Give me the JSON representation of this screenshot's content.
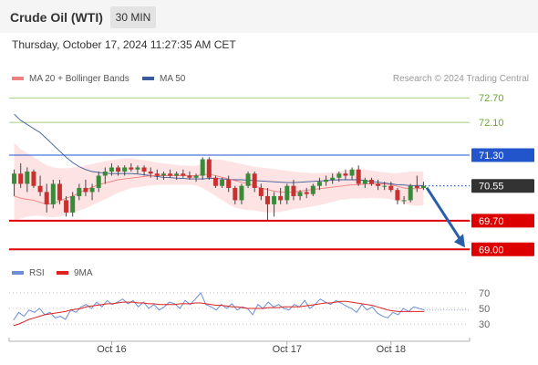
{
  "header": {
    "instrument": "Crude Oil (WTI)",
    "timeframe": "30 MIN"
  },
  "timestamp": "Thursday, October 17, 2024 11:27:35 AM CET",
  "legend": {
    "ma20": {
      "label": "MA 20 + Bollinger Bands",
      "color": "#f08080"
    },
    "ma50": {
      "label": "MA 50",
      "color": "#3a5a9a"
    }
  },
  "source": "Research © 2024 Trading Central",
  "rsi_legend": {
    "rsi": {
      "label": "RSI",
      "color": "#6b8ed6"
    },
    "ma9": {
      "label": "9MA",
      "color": "#dd2222"
    }
  },
  "chart_data": {
    "type": "candlestick",
    "price_levels": [
      {
        "value": 72.7,
        "label": "72.70",
        "color": "#8bbf57",
        "style": "thin"
      },
      {
        "value": 72.1,
        "label": "72.10",
        "color": "#8bbf57",
        "style": "thin"
      },
      {
        "value": 71.3,
        "label": "71.30",
        "color": "#2255cc",
        "badge": "#2255cc",
        "badge_text": "#ffffff"
      },
      {
        "value": 70.55,
        "label": "70.55",
        "color": "#555555",
        "badge": "#333333",
        "badge_text": "#ffffff",
        "current": true
      },
      {
        "value": 69.7,
        "label": "69.70",
        "color": "#dd0000",
        "badge": "#dd0000",
        "badge_text": "#ffffff"
      },
      {
        "value": 69.0,
        "label": "69.00",
        "color": "#dd0000",
        "badge": "#dd0000",
        "badge_text": "#ffffff"
      }
    ],
    "price_range": [
      68.85,
      72.95
    ],
    "projection": {
      "from": 70.55,
      "to": 69.0
    },
    "candles": [
      [
        70.6,
        70.95,
        70.3,
        70.85
      ],
      [
        70.85,
        71.1,
        70.5,
        70.6
      ],
      [
        70.6,
        71.0,
        70.4,
        70.9
      ],
      [
        70.9,
        70.95,
        70.5,
        70.55
      ],
      [
        70.55,
        70.8,
        70.3,
        70.4
      ],
      [
        70.4,
        70.6,
        69.9,
        70.1
      ],
      [
        70.1,
        70.7,
        70.0,
        70.6
      ],
      [
        70.6,
        70.7,
        70.1,
        70.2
      ],
      [
        70.2,
        70.3,
        69.8,
        69.9
      ],
      [
        69.9,
        70.4,
        69.8,
        70.3
      ],
      [
        70.3,
        70.6,
        70.2,
        70.5
      ],
      [
        70.5,
        70.7,
        70.3,
        70.4
      ],
      [
        70.4,
        70.6,
        70.2,
        70.5
      ],
      [
        70.5,
        70.9,
        70.4,
        70.8
      ],
      [
        70.8,
        71.0,
        70.6,
        70.9
      ],
      [
        70.9,
        71.1,
        70.8,
        71.0
      ],
      [
        71.0,
        71.05,
        70.8,
        70.9
      ],
      [
        70.9,
        71.05,
        70.8,
        71.0
      ],
      [
        71.0,
        71.1,
        70.9,
        70.95
      ],
      [
        70.95,
        71.05,
        70.85,
        71.0
      ],
      [
        71.0,
        71.05,
        70.8,
        70.9
      ],
      [
        70.9,
        71.0,
        70.75,
        70.85
      ],
      [
        70.85,
        70.95,
        70.7,
        70.8
      ],
      [
        70.8,
        70.9,
        70.7,
        70.85
      ],
      [
        70.85,
        70.95,
        70.75,
        70.8
      ],
      [
        70.8,
        70.9,
        70.7,
        70.85
      ],
      [
        70.85,
        70.95,
        70.75,
        70.8
      ],
      [
        70.8,
        70.9,
        70.7,
        70.75
      ],
      [
        70.75,
        70.85,
        70.65,
        70.8
      ],
      [
        70.8,
        71.25,
        70.7,
        71.2
      ],
      [
        71.2,
        71.25,
        70.7,
        70.75
      ],
      [
        70.75,
        70.8,
        70.5,
        70.55
      ],
      [
        70.55,
        70.75,
        70.5,
        70.7
      ],
      [
        70.7,
        70.8,
        70.4,
        70.5
      ],
      [
        70.5,
        70.55,
        70.1,
        70.2
      ],
      [
        70.2,
        70.6,
        70.1,
        70.55
      ],
      [
        70.55,
        70.9,
        70.5,
        70.85
      ],
      [
        70.85,
        70.9,
        70.4,
        70.5
      ],
      [
        70.5,
        70.6,
        70.2,
        70.3
      ],
      [
        70.3,
        70.5,
        69.7,
        70.1
      ],
      [
        70.1,
        70.4,
        69.8,
        70.3
      ],
      [
        70.3,
        70.5,
        70.1,
        70.2
      ],
      [
        70.2,
        70.6,
        70.1,
        70.55
      ],
      [
        70.55,
        70.7,
        70.2,
        70.3
      ],
      [
        70.3,
        70.45,
        70.2,
        70.4
      ],
      [
        70.4,
        70.5,
        70.25,
        70.35
      ],
      [
        70.35,
        70.6,
        70.3,
        70.55
      ],
      [
        70.55,
        70.75,
        70.45,
        70.65
      ],
      [
        70.65,
        70.8,
        70.55,
        70.7
      ],
      [
        70.7,
        70.85,
        70.6,
        70.75
      ],
      [
        70.75,
        70.9,
        70.65,
        70.85
      ],
      [
        70.85,
        70.95,
        70.7,
        70.8
      ],
      [
        70.8,
        71.0,
        70.7,
        70.95
      ],
      [
        70.95,
        71.05,
        70.55,
        70.6
      ],
      [
        70.6,
        70.75,
        70.5,
        70.7
      ],
      [
        70.7,
        70.75,
        70.55,
        70.6
      ],
      [
        70.6,
        70.7,
        70.45,
        70.55
      ],
      [
        70.55,
        70.65,
        70.45,
        70.55
      ],
      [
        70.55,
        70.65,
        70.4,
        70.45
      ],
      [
        70.45,
        70.5,
        70.1,
        70.2
      ],
      [
        70.2,
        70.3,
        70.1,
        70.2
      ],
      [
        70.2,
        70.6,
        70.15,
        70.55
      ],
      [
        70.55,
        70.8,
        70.4,
        70.5
      ],
      [
        70.5,
        70.65,
        70.45,
        70.55
      ]
    ],
    "ma20": [
      70.3,
      70.25,
      70.22,
      70.2,
      70.15,
      70.1,
      70.12,
      70.18,
      70.25,
      70.3,
      70.38,
      70.45,
      70.52,
      70.58,
      70.62,
      70.66,
      70.7,
      70.72,
      70.74,
      70.76,
      70.78,
      70.8,
      70.8,
      70.8,
      70.8,
      70.8,
      70.8,
      70.8,
      70.8,
      70.82,
      70.84,
      70.8,
      70.76,
      70.72,
      70.68,
      70.64,
      70.6,
      70.55,
      70.5,
      70.46,
      70.42,
      70.4,
      70.4,
      70.4,
      70.42,
      70.44,
      70.46,
      70.48,
      70.5,
      70.52,
      70.54,
      70.56,
      70.58,
      70.58,
      70.6,
      70.6,
      70.6,
      70.6,
      70.58,
      70.54,
      70.5,
      70.48,
      70.48,
      70.5
    ],
    "bb_upper": [
      71.6,
      71.45,
      71.35,
      71.25,
      71.15,
      71.05,
      71.0,
      70.98,
      70.98,
      71.0,
      71.02,
      71.05,
      71.08,
      71.12,
      71.15,
      71.18,
      71.2,
      71.22,
      71.22,
      71.2,
      71.18,
      71.15,
      71.12,
      71.1,
      71.08,
      71.06,
      71.05,
      71.04,
      71.04,
      71.1,
      71.18,
      71.2,
      71.18,
      71.15,
      71.12,
      71.08,
      71.05,
      71.02,
      71.0,
      70.98,
      70.96,
      70.94,
      70.92,
      70.9,
      70.88,
      70.87,
      70.86,
      70.86,
      70.87,
      70.88,
      70.9,
      70.92,
      70.95,
      70.96,
      70.95,
      70.92,
      70.9,
      70.88,
      70.86,
      70.86,
      70.88,
      70.9,
      70.9,
      70.9
    ],
    "bb_lower": [
      69.7,
      69.75,
      69.8,
      69.82,
      69.82,
      69.8,
      69.78,
      69.8,
      69.85,
      69.9,
      69.95,
      70.0,
      70.08,
      70.15,
      70.22,
      70.3,
      70.38,
      70.44,
      70.5,
      70.52,
      70.54,
      70.56,
      70.57,
      70.58,
      70.58,
      70.58,
      70.58,
      70.58,
      70.56,
      70.5,
      70.4,
      70.3,
      70.2,
      70.1,
      70.02,
      69.98,
      69.96,
      69.95,
      69.92,
      69.9,
      69.9,
      69.92,
      69.95,
      69.98,
      70.0,
      70.02,
      70.05,
      70.08,
      70.12,
      70.16,
      70.2,
      70.22,
      70.24,
      70.24,
      70.25,
      70.26,
      70.25,
      70.24,
      70.22,
      70.18,
      70.12,
      70.08,
      70.06,
      70.08
    ],
    "ma50": [
      72.3,
      72.15,
      72.05,
      71.95,
      71.85,
      71.7,
      71.55,
      71.4,
      71.25,
      71.12,
      71.02,
      70.95,
      70.9,
      70.88,
      70.86,
      70.85,
      70.85,
      70.85,
      70.85,
      70.84,
      70.82,
      70.8,
      70.78,
      70.76,
      70.75,
      70.74,
      70.73,
      70.72,
      70.72,
      70.72,
      70.73,
      70.73,
      70.72,
      70.71,
      70.7,
      70.7,
      70.69,
      70.68,
      70.67,
      70.66,
      70.65,
      70.64,
      70.63,
      70.63,
      70.64,
      70.65,
      70.66,
      70.67,
      70.68,
      70.69,
      70.7,
      70.7,
      70.7,
      70.7,
      70.68,
      70.66,
      70.64,
      70.62,
      70.6,
      70.58,
      70.57,
      70.56,
      70.56,
      70.56
    ],
    "rsi": {
      "levels": [
        70,
        50,
        30
      ],
      "range": [
        15,
        85
      ],
      "rsi_values": [
        35,
        45,
        40,
        48,
        45,
        50,
        42,
        45,
        38,
        40,
        36,
        48,
        45,
        52,
        55,
        50,
        58,
        52,
        60,
        55,
        58,
        62,
        56,
        60,
        52,
        58,
        50,
        55,
        48,
        52,
        58,
        56,
        50,
        60,
        55,
        62,
        70,
        55,
        52,
        48,
        55,
        50,
        56,
        48,
        52,
        50,
        42,
        55,
        50,
        58,
        52,
        55,
        50,
        48,
        55,
        52,
        60,
        50,
        55,
        62,
        58,
        55,
        60,
        57,
        53,
        50,
        45,
        55,
        48,
        52,
        44,
        40,
        38,
        45,
        42,
        50,
        46,
        52,
        50,
        48
      ],
      "ma9_values": [
        28,
        30,
        33,
        36,
        38,
        40,
        42,
        43,
        44,
        45,
        46,
        48,
        49,
        50,
        52,
        53,
        54,
        55,
        56,
        56,
        57,
        58,
        58,
        58,
        57,
        57,
        56,
        56,
        55,
        55,
        55,
        55,
        56,
        56,
        56,
        57,
        57,
        56,
        55,
        54,
        54,
        53,
        52,
        52,
        51,
        50,
        50,
        50,
        50,
        51,
        51,
        51,
        52,
        52,
        52,
        52,
        53,
        54,
        55,
        56,
        57,
        57,
        58,
        59,
        59,
        58,
        57,
        56,
        55,
        54,
        52,
        50,
        48,
        47,
        46,
        46,
        46,
        46,
        46,
        46
      ]
    },
    "x_ticks": [
      {
        "label": "Oct 16",
        "index": 15
      },
      {
        "label": "Oct 17",
        "index": 42
      },
      {
        "label": "Oct 18",
        "index": 58
      }
    ]
  }
}
